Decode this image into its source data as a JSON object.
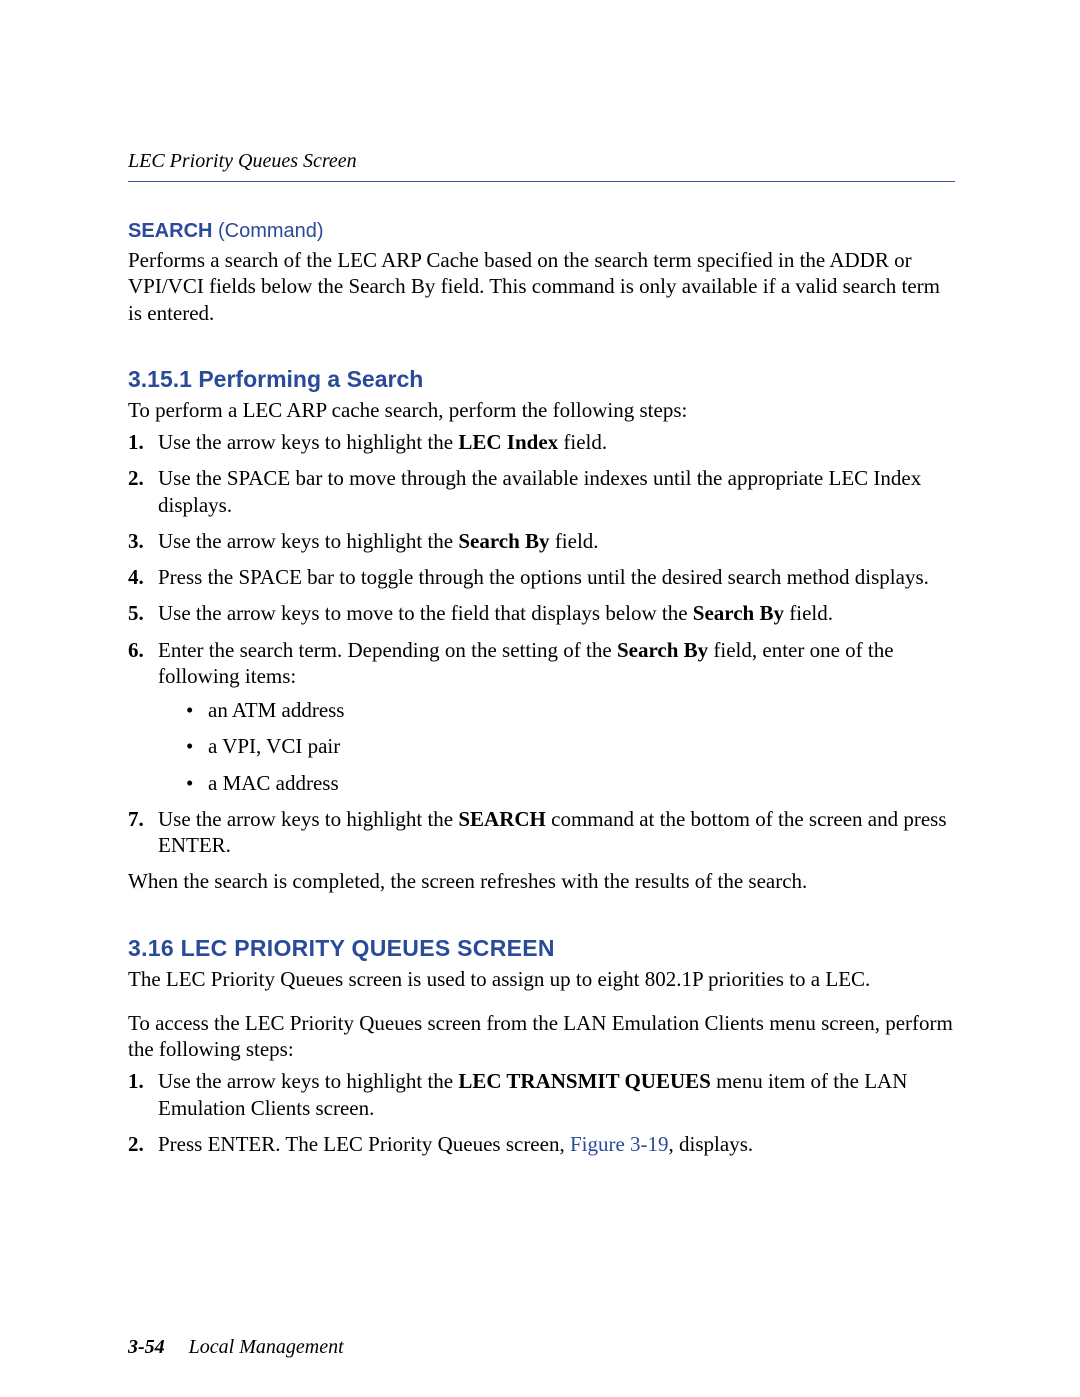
{
  "header": {
    "running_title": "LEC Priority Queues Screen"
  },
  "search_cmd": {
    "label_bold": "SEARCH",
    "label_rest": " (Command)",
    "description": "Performs a search of the LEC ARP Cache based on the search term specified in the ADDR or VPI/VCI fields below the Search By field. This command is only available if a valid search term is entered."
  },
  "section_3_15_1": {
    "heading": "3.15.1   Performing a Search",
    "intro": "To perform a LEC ARP cache search, perform the following steps:",
    "steps": {
      "s1_pre": "Use the arrow keys to highlight the ",
      "s1_bold": "LEC Index",
      "s1_post": " field.",
      "s2": "Use the SPACE bar to move through the available indexes until the appropriate LEC Index displays.",
      "s3_pre": "Use the arrow keys to highlight the ",
      "s3_bold": "Search By",
      "s3_post": " field.",
      "s4": "Press the SPACE bar to toggle through the options until the desired search method displays.",
      "s5_pre": "Use the arrow keys to move to the field that displays below the ",
      "s5_bold": "Search By",
      "s5_post": " field.",
      "s6_pre": "Enter the search term. Depending on the setting of the ",
      "s6_bold": "Search By",
      "s6_post": " field, enter one of the following items:",
      "s6_bullets": {
        "b1": "an ATM address",
        "b2": "a VPI, VCI pair",
        "b3": "a MAC address"
      },
      "s7_pre": "Use the arrow keys to highlight the ",
      "s7_bold": "SEARCH",
      "s7_post": " command at the bottom of the screen and press ENTER."
    },
    "closing": "When the search is completed, the screen refreshes with the results of the search."
  },
  "section_3_16": {
    "heading": "3.16   LEC PRIORITY QUEUES SCREEN",
    "para1": "The LEC Priority Queues screen is used to assign up to eight 802.1P priorities to a LEC.",
    "para2": "To access the LEC Priority Queues screen from the LAN Emulation Clients menu screen, perform the following steps:",
    "steps": {
      "s1_pre": "Use the arrow keys to highlight the ",
      "s1_bold": "LEC TRANSMIT QUEUES",
      "s1_post": " menu item of the LAN Emulation Clients screen.",
      "s2_pre": "Press ENTER. The LEC Priority Queues screen, ",
      "s2_link": "Figure 3-19",
      "s2_post": ", displays."
    }
  },
  "footer": {
    "page": "3-54",
    "book": "Local Management"
  }
}
